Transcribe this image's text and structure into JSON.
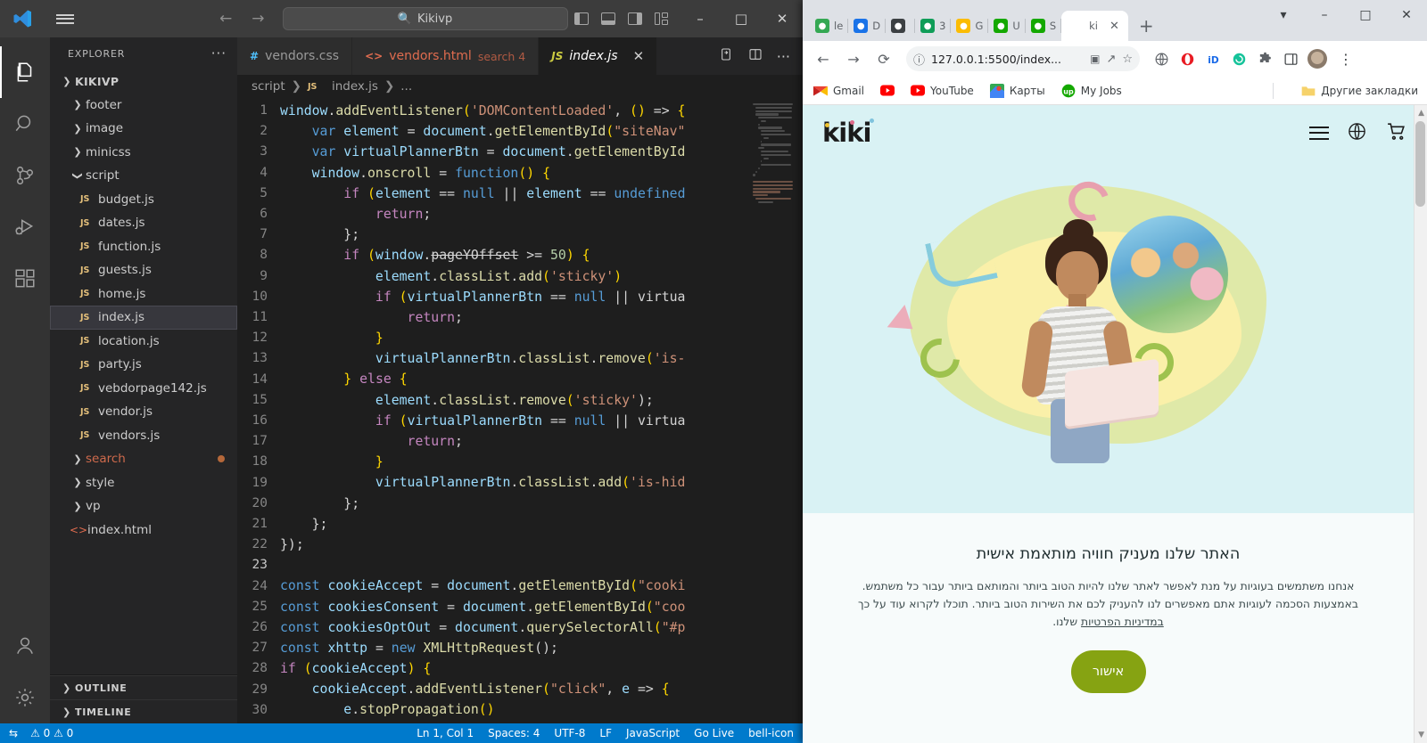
{
  "vscode": {
    "titlebar": {
      "search_text": "Kikivp",
      "search_icon": "search-icon",
      "back_icon": "arrow-left-icon",
      "forward_icon": "arrow-right-icon",
      "minimize": "–",
      "maximize": "□",
      "close": "✕"
    },
    "activitybar": [
      {
        "name": "explorer",
        "icon": "files-icon",
        "active": true
      },
      {
        "name": "search",
        "icon": "search-icon",
        "active": false
      },
      {
        "name": "source-control",
        "icon": "source-control-icon",
        "active": false
      },
      {
        "name": "run-and-debug",
        "icon": "run-debug-icon",
        "active": false
      },
      {
        "name": "extensions",
        "icon": "extensions-icon",
        "active": false
      },
      {
        "name": "accounts",
        "icon": "account-icon",
        "active": false
      },
      {
        "name": "settings",
        "icon": "gear-icon",
        "active": false
      }
    ],
    "sidebar": {
      "title": "EXPLORER",
      "more_actions": "···",
      "root": "KIKIVP",
      "tree": [
        {
          "label": "footer",
          "type": "folder",
          "indent": 1,
          "expanded": false
        },
        {
          "label": "image",
          "type": "folder",
          "indent": 1,
          "expanded": false
        },
        {
          "label": "minicss",
          "type": "folder",
          "indent": 1,
          "expanded": false
        },
        {
          "label": "script",
          "type": "folder",
          "indent": 1,
          "expanded": true
        },
        {
          "label": "budget.js",
          "type": "js",
          "indent": 2
        },
        {
          "label": "dates.js",
          "type": "js",
          "indent": 2
        },
        {
          "label": "function.js",
          "type": "js",
          "indent": 2
        },
        {
          "label": "guests.js",
          "type": "js",
          "indent": 2
        },
        {
          "label": "home.js",
          "type": "js",
          "indent": 2
        },
        {
          "label": "index.js",
          "type": "js",
          "indent": 2,
          "selected": true
        },
        {
          "label": "location.js",
          "type": "js",
          "indent": 2
        },
        {
          "label": "party.js",
          "type": "js",
          "indent": 2
        },
        {
          "label": "vebdorpage142.js",
          "type": "js",
          "indent": 2
        },
        {
          "label": "vendor.js",
          "type": "js",
          "indent": 2
        },
        {
          "label": "vendors.js",
          "type": "js",
          "indent": 2
        },
        {
          "label": "search",
          "type": "folder",
          "indent": 1,
          "expanded": false,
          "modified": true
        },
        {
          "label": "style",
          "type": "folder",
          "indent": 1,
          "expanded": false
        },
        {
          "label": "vp",
          "type": "folder",
          "indent": 1,
          "expanded": false
        },
        {
          "label": "index.html",
          "type": "html",
          "indent": 1
        }
      ],
      "sections": [
        "OUTLINE",
        "TIMELINE"
      ]
    },
    "tabs": [
      {
        "label": "vendors.css",
        "icon": "#",
        "icon_color": "#4fc1ff",
        "sub": "",
        "active": false,
        "closable": false
      },
      {
        "label": "vendors.html",
        "icon": "<>",
        "icon_color": "#e06c4f",
        "sub": "search 4",
        "active": false,
        "closable": false,
        "kind": "html"
      },
      {
        "label": "index.js",
        "icon": "JS",
        "icon_color": "#cbcb41",
        "sub": "",
        "active": true,
        "closable": true
      }
    ],
    "tab_actions": [
      "split-editor-right-icon",
      "open-changes-icon",
      "more-actions-icon"
    ],
    "breadcrumb": [
      "script",
      "index.js",
      "..."
    ],
    "breadcrumb_icon": "JS",
    "code": {
      "first_line": 1,
      "lines": [
        "window.addEventListener('DOMContentLoaded', () => {",
        "    var element = document.getElementById(\"siteNav\"",
        "    var virtualPlannerBtn = document.getElementById",
        "    window.onscroll = function() {",
        "        if (element == null || element == undefined",
        "            return;",
        "        };",
        "        if (window.pageYOffset >= 50) {",
        "            element.classList.add('sticky')",
        "            if (virtualPlannerBtn == null || virtua",
        "                return;",
        "            }",
        "            virtualPlannerBtn.classList.remove('is-",
        "        } else {",
        "            element.classList.remove('sticky');",
        "            if (virtualPlannerBtn == null || virtua",
        "                return;",
        "            }",
        "            virtualPlannerBtn.classList.add('is-hid",
        "        };",
        "    };",
        "});",
        "",
        "const cookieAccept = document.getElementById(\"cooki",
        "const cookiesConsent = document.getElementById(\"coo",
        "const cookiesOptOut = document.querySelectorAll(\"#p",
        "const xhttp = new XMLHttpRequest();",
        "if (cookieAccept) {",
        "    cookieAccept.addEventListener(\"click\", e => {",
        "        e.stopPropagation()"
      ],
      "cursor_line": 23
    },
    "statusbar": {
      "left": [
        "remote-icon",
        "error-warning-icon"
      ],
      "right": [
        "Ln 1, Col 1",
        "Spaces: 4",
        "UTF-8",
        "LF",
        "JavaScript",
        "Go Live",
        "bell-icon"
      ]
    }
  },
  "chrome": {
    "tabs": [
      {
        "favicon": "drive-icon",
        "label": "le",
        "color": "#34a853",
        "active": false
      },
      {
        "favicon": "chat-icon",
        "label": "D",
        "color": "#1a73e8",
        "active": false
      },
      {
        "favicon": "contacts-icon",
        "label": "",
        "color": "#3c4043",
        "active": false
      },
      {
        "favicon": "sheets-icon",
        "label": "3",
        "color": "#0f9d58",
        "active": false
      },
      {
        "favicon": "drive-icon",
        "label": "G",
        "color": "#fbbc04",
        "active": false
      },
      {
        "favicon": "upwork-icon",
        "label": "U",
        "color": "#14a800",
        "active": false
      },
      {
        "favicon": "upwork-icon",
        "label": "S",
        "color": "#14a800",
        "active": false
      },
      {
        "favicon": "kiki-icon",
        "label": "ki",
        "color": "#ffffff",
        "active": true
      }
    ],
    "new_tab_icon": "+",
    "tab_search_icon": "chevron-down-icon",
    "window_controls": {
      "minimize": "–",
      "maximize": "□",
      "close": "✕"
    },
    "toolbar": {
      "back_icon": "arrow-left-icon",
      "forward_icon": "arrow-right-icon",
      "reload_icon": "reload-icon",
      "url": "127.0.0.1:5500/index...",
      "info_icon": "info-circle-icon",
      "translate_icon": "translate-icon",
      "share_icon": "share-icon",
      "bookmark_icon": "star-icon",
      "extensions": [
        "globe-ext-icon",
        "opera-ext-icon",
        "id-ext-icon",
        "grammar-ext-icon",
        "puzzle-icon",
        "sidepanel-icon"
      ],
      "profile_icon": "avatar-icon",
      "menu_icon": "kebab-menu-icon"
    },
    "bookmarks": [
      {
        "label": "Gmail",
        "icon": "gmail-icon"
      },
      {
        "label": "",
        "icon": "youtube-icon"
      },
      {
        "label": "YouTube",
        "icon": "youtube-icon"
      },
      {
        "label": "Карты",
        "icon": "maps-icon"
      },
      {
        "label": "My Jobs",
        "icon": "upwork-icon"
      }
    ],
    "bookmarks_other": {
      "label": "Другие закладки",
      "icon": "folder-icon"
    }
  },
  "page": {
    "logo": "kiki",
    "header_icons": [
      "menu-icon",
      "globe-icon",
      "cart-icon"
    ],
    "cookie": {
      "title": "האתר שלנו מעניק חוויה מותאמת אישית",
      "body_line1": "אנחנו משתמשים בעוגיות על מנת לאפשר לאתר שלנו להיות הטוב ביותר והמותאם ביותר עבור כל משתמש.",
      "body_line2_a": "באמצעות הסכמה לעוגיות אתם מאפשרים לנו להעניק לכם את השירות הטוב ביותר. תוכלו לקרוא עוד על כך ",
      "body_link": "במדיניות הפרטיות",
      "body_line2_b": " שלנו.",
      "accept_button": "אישור"
    },
    "colors": {
      "hero_bg": "#d9f2f4",
      "accept_button": "#86a312",
      "banner_bg": "#f7fbfb"
    }
  }
}
